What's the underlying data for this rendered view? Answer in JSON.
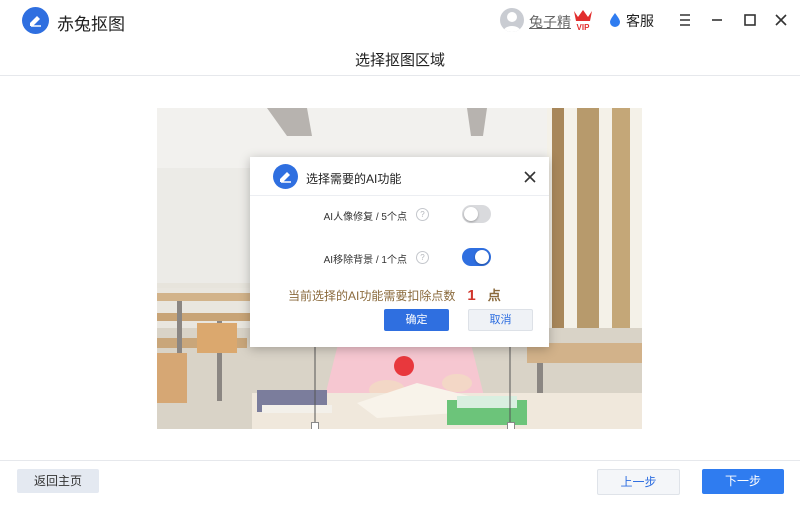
{
  "app": {
    "title": "赤兔抠图",
    "brand_color": "#2f6fe0"
  },
  "user": {
    "name": "兔子精",
    "badge": "VIP"
  },
  "header": {
    "service_label": "客服"
  },
  "page": {
    "title": "选择抠图区域"
  },
  "icons": [
    "app-logo-icon",
    "avatar-icon",
    "vip-crown-icon",
    "service-drop-icon",
    "menu-icon",
    "minimize-icon",
    "maximize-icon",
    "close-icon",
    "help-icon"
  ],
  "modal": {
    "title": "选择需要的AI功能",
    "options": [
      {
        "label": "AI人像修复 / 5个点",
        "enabled": false
      },
      {
        "label": "AI移除背景 / 1个点",
        "enabled": true
      }
    ],
    "help_glyph": "?",
    "cost_text": "当前选择的AI功能需要扣除点数",
    "cost_value": "1",
    "cost_unit": "点",
    "confirm_label": "确定",
    "cancel_label": "取消"
  },
  "footer": {
    "home_label": "返回主页",
    "prev_label": "上一步",
    "next_label": "下一步"
  }
}
